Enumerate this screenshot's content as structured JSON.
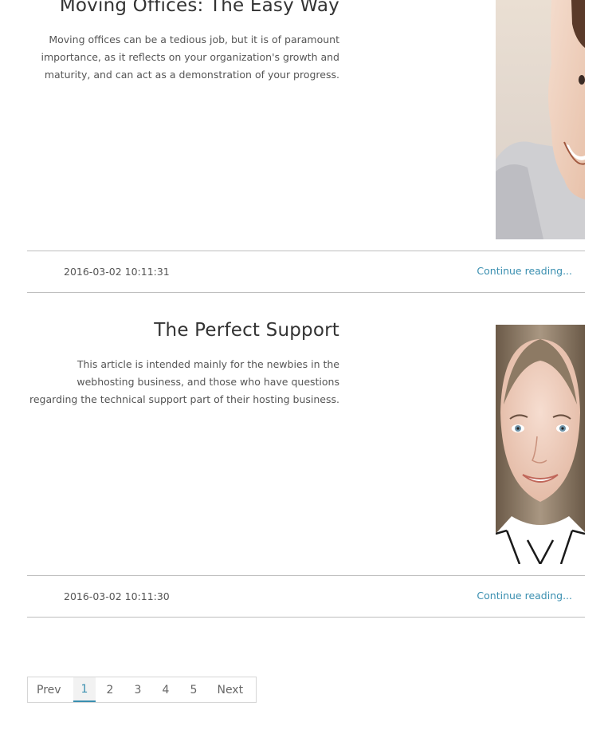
{
  "posts": [
    {
      "title": "Moving Offices: The Easy Way",
      "excerpt": "Moving offices can be a tedious job, but it is of paramount importance, as it reflects on your organization's growth and maturity, and can act as a demonstration of your progress.",
      "date": "2016-03-02 10:11:31",
      "link": "Continue reading...",
      "image": "smiling-woman-photo"
    },
    {
      "title": "The Perfect Support",
      "excerpt": "This article is intended mainly for the newbies in the webhosting business, and those who have questions regarding the technical support part of their hosting business.",
      "date": "2016-03-02 10:11:30",
      "link": "Continue reading...",
      "image": "woman-portrait-photo"
    }
  ],
  "pagination": {
    "prev": "Prev",
    "pages": [
      "1",
      "2",
      "3",
      "4",
      "5"
    ],
    "next": "Next",
    "current": "1"
  },
  "colors": {
    "link": "#3a8fb0",
    "text": "#555555",
    "divider": "#bdbdbd"
  }
}
